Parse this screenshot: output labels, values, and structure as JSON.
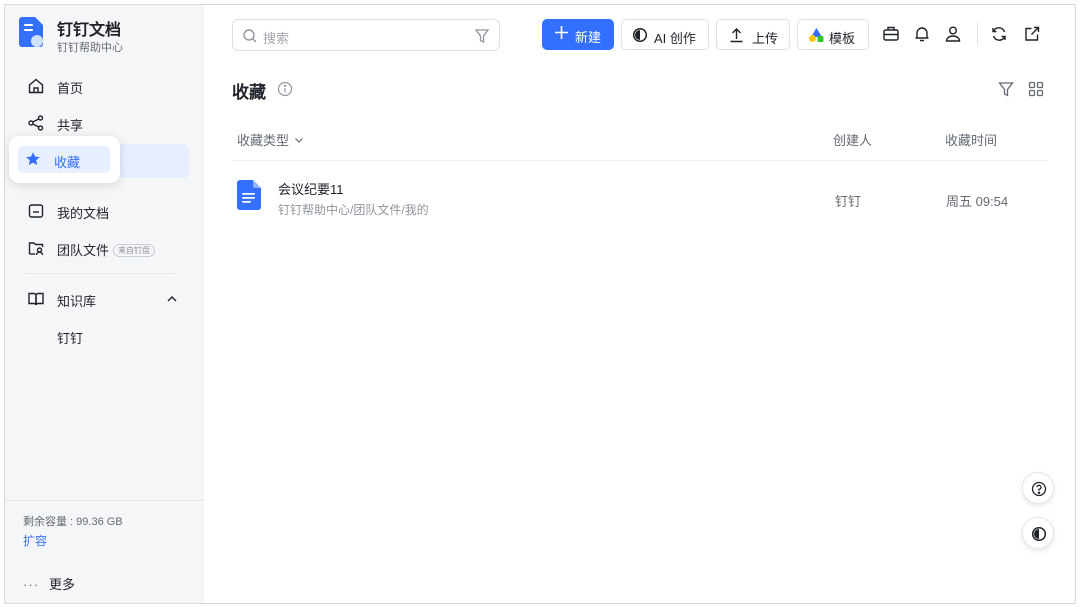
{
  "brand": {
    "title": "钉钉文档",
    "subtitle": "钉钉帮助中心"
  },
  "sidebar": {
    "items": [
      {
        "label": "首页",
        "icon": "home-icon"
      },
      {
        "label": "共享",
        "icon": "share-icon"
      },
      {
        "label": "收藏",
        "icon": "star-icon",
        "active": true
      },
      {
        "label": "我的文档",
        "icon": "folder-icon"
      },
      {
        "label": "团队文件",
        "icon": "team-folder-icon",
        "badge": "来自钉盘"
      },
      {
        "label": "知识库",
        "icon": "book-icon",
        "expanded": true
      }
    ],
    "knowledge_children": [
      "钉钉"
    ],
    "storage": "剩余容量 : 99.36 GB",
    "expand_label": "扩容",
    "more_label": "更多",
    "more_dots": "···"
  },
  "topbar": {
    "search_placeholder": "搜索",
    "new_label": "新建",
    "ai_label": "AI 创作",
    "upload_label": "上传",
    "template_label": "模板"
  },
  "main": {
    "title": "收藏",
    "columns": {
      "type": "收藏类型",
      "creator": "创建人",
      "time": "收藏时间"
    },
    "rows": [
      {
        "name": "会议纪要11",
        "path": "钉钉帮助中心/团队文件/我的",
        "creator": "钉钉",
        "time": "周五 09:54"
      }
    ]
  },
  "colors": {
    "accent": "#3370ff",
    "sidebar_bg": "#f5f6f7",
    "active_bg": "#e6eeff"
  }
}
